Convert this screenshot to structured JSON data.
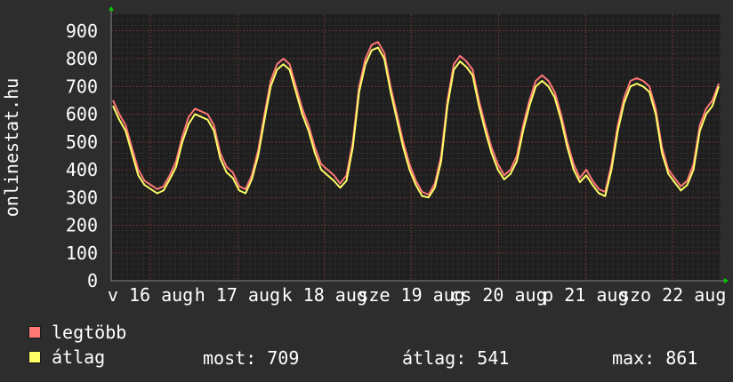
{
  "chart_data": {
    "type": "line",
    "ylabel": "onlinestat.hu",
    "ylim": [
      0,
      960
    ],
    "yticks": [
      0,
      100,
      200,
      300,
      400,
      500,
      600,
      700,
      800,
      900
    ],
    "x_ticks": [
      "v 16 aug",
      "h 17 aug",
      "k 18 aug",
      "sze 19 aug",
      "cs 20 aug",
      "p 21 aug",
      "szo 22 aug"
    ],
    "grid": true,
    "colors": {
      "background": "#2d2d2d",
      "plot_background": "#1e1e1e",
      "grid_minor": "#3a3a3a",
      "grid_major": "#6a3333",
      "max_series": "#e06060",
      "avg_series": "#ffff66",
      "axis_arrow": "#00cc00"
    },
    "series": [
      {
        "name": "legtöbb",
        "color": "#ff7777",
        "values": [
          650,
          600,
          560,
          480,
          400,
          360,
          345,
          330,
          340,
          380,
          430,
          520,
          590,
          620,
          610,
          600,
          560,
          460,
          410,
          390,
          340,
          330,
          380,
          470,
          600,
          720,
          780,
          800,
          780,
          700,
          620,
          560,
          480,
          420,
          400,
          380,
          350,
          380,
          500,
          700,
          800,
          850,
          860,
          820,
          700,
          600,
          500,
          420,
          360,
          320,
          310,
          350,
          450,
          650,
          780,
          810,
          790,
          760,
          650,
          560,
          480,
          420,
          380,
          400,
          450,
          560,
          650,
          720,
          740,
          720,
          680,
          600,
          500,
          420,
          370,
          400,
          360,
          330,
          320,
          420,
          560,
          660,
          720,
          730,
          720,
          700,
          620,
          480,
          400,
          370,
          340,
          360,
          420,
          560,
          620,
          650,
          710
        ]
      },
      {
        "name": "átlag",
        "color": "#ffff66",
        "values": [
          630,
          580,
          540,
          460,
          380,
          345,
          330,
          315,
          325,
          365,
          410,
          500,
          565,
          600,
          590,
          580,
          540,
          440,
          390,
          370,
          325,
          315,
          365,
          450,
          580,
          700,
          760,
          780,
          760,
          680,
          600,
          540,
          460,
          400,
          380,
          360,
          335,
          360,
          480,
          680,
          780,
          830,
          840,
          800,
          680,
          580,
          480,
          400,
          345,
          305,
          300,
          335,
          430,
          630,
          760,
          790,
          770,
          740,
          630,
          540,
          460,
          400,
          365,
          385,
          430,
          540,
          630,
          700,
          720,
          700,
          660,
          580,
          480,
          400,
          355,
          380,
          345,
          315,
          305,
          400,
          540,
          640,
          700,
          710,
          700,
          680,
          600,
          460,
          385,
          355,
          325,
          345,
          400,
          540,
          600,
          630,
          700
        ]
      }
    ]
  },
  "legend": {
    "max_label": "legtöbb",
    "avg_label": "átlag",
    "max_color": "#ff7777",
    "avg_color": "#ffff66"
  },
  "stats": {
    "most": "most: 709",
    "atlag": "átlag: 541",
    "max": "max: 861"
  }
}
